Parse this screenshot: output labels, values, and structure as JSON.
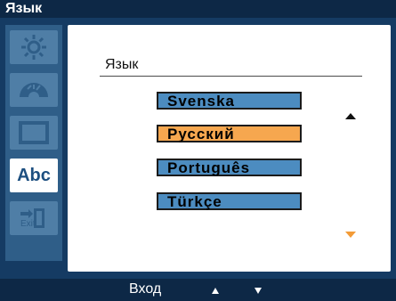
{
  "title": "Язык",
  "sidebar": {
    "items": [
      {
        "name": "brightness"
      },
      {
        "name": "color"
      },
      {
        "name": "picture"
      },
      {
        "name": "language",
        "label": "Abc"
      },
      {
        "name": "exit",
        "label": "Exit"
      }
    ]
  },
  "content": {
    "heading": "Язык",
    "options": [
      {
        "label": "Svenska",
        "selected": false
      },
      {
        "label": "Русский",
        "selected": true
      },
      {
        "label": "Português",
        "selected": false
      },
      {
        "label": "Türkçe",
        "selected": false
      }
    ]
  },
  "footer": {
    "enter": "Вход"
  },
  "colors": {
    "frame": "#153b63",
    "sidebar": "#2f5e88",
    "selected": "#f6a74f",
    "option": "#4c8cc0"
  }
}
